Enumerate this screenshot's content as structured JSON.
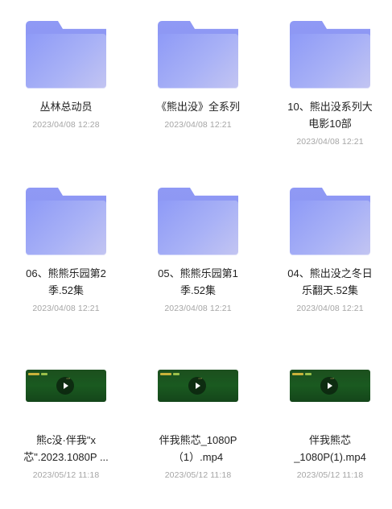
{
  "items": [
    {
      "type": "folder",
      "name_line1": "丛林总动员",
      "name_line2": "",
      "date": "2023/04/08 12:28"
    },
    {
      "type": "folder",
      "name_line1": "《熊出没》全系列",
      "name_line2": "",
      "date": "2023/04/08 12:21"
    },
    {
      "type": "folder",
      "name_line1": "10、熊出没系列大",
      "name_line2": "电影10部",
      "date": "2023/04/08 12:21"
    },
    {
      "type": "folder",
      "name_line1": "06、熊熊乐园第2",
      "name_line2": "季.52集",
      "date": "2023/04/08 12:21"
    },
    {
      "type": "folder",
      "name_line1": "05、熊熊乐园第1",
      "name_line2": "季.52集",
      "date": "2023/04/08 12:21"
    },
    {
      "type": "folder",
      "name_line1": "04、熊出没之冬日",
      "name_line2": "乐翻天.52集",
      "date": "2023/04/08 12:21"
    },
    {
      "type": "video",
      "name_line1": "熊c没·伴我\"x",
      "name_line2": "芯\".2023.1080P ...",
      "date": "2023/05/12 11:18"
    },
    {
      "type": "video",
      "name_line1": "伴我熊芯_1080P",
      "name_line2": "（1）.mp4",
      "date": "2023/05/12 11:18"
    },
    {
      "type": "video",
      "name_line1": "伴我熊芯",
      "name_line2": "_1080P(1).mp4",
      "date": "2023/05/12 11:18"
    }
  ]
}
